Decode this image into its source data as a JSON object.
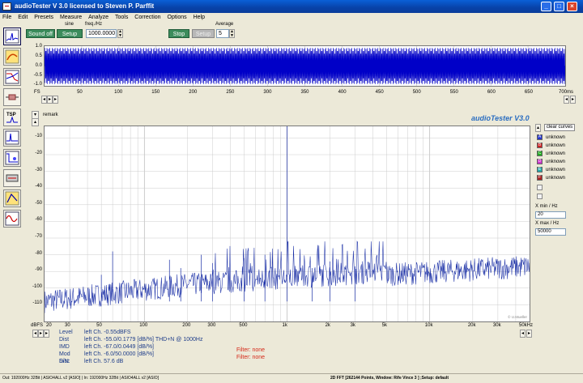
{
  "window": {
    "title": "audioTester  V 3.0   licensed to Steven P. Parffit",
    "min": "_",
    "max": "□",
    "close": "×"
  },
  "menu": [
    "File",
    "Edit",
    "Presets",
    "Measure",
    "Analyze",
    "Tools",
    "Correction",
    "Options",
    "Help"
  ],
  "toolbar": {
    "sound_off": "Sound off",
    "sine_label": "sine",
    "setup1": "Setup",
    "freq_label": "freq./Hz",
    "freq_value": "1000.0000",
    "stop": "Stop",
    "setup2": "Setup",
    "average_label": "Average",
    "average_value": "5"
  },
  "scope": {
    "y_ticks": [
      "1.0",
      "0.5",
      "0.0",
      "-0.5",
      "-1.0"
    ],
    "x_ticks": [
      "50",
      "100",
      "150",
      "200",
      "250",
      "300",
      "350",
      "400",
      "450",
      "500",
      "550",
      "600",
      "650",
      "700ms"
    ],
    "fs_label": "FS",
    "color": "#0000c8"
  },
  "remark": "remark",
  "brand": "audioTester  V3.0",
  "fft": {
    "y_ticks": [
      "-10",
      "-20",
      "-30",
      "-40",
      "-50",
      "-60",
      "-70",
      "-80",
      "-90",
      "-100",
      "-110"
    ],
    "y_unit": "dBFS",
    "x_ticks": [
      "20",
      "30",
      "50",
      "100",
      "200",
      "300",
      "500",
      "1k",
      "2k",
      "3k",
      "5k",
      "10k",
      "20k",
      "30k",
      "50kHz"
    ],
    "watermark": "© U.Mueller",
    "color": "#1a2fa6"
  },
  "legend": {
    "clear": "clear curves",
    "items": [
      {
        "letter": "A",
        "label": "unknown",
        "color": "#2233cc"
      },
      {
        "letter": "B",
        "label": "unknown",
        "color": "#cc2222"
      },
      {
        "letter": "C",
        "label": "unknown",
        "color": "#22aa22"
      },
      {
        "letter": "D",
        "label": "unknown",
        "color": "#cc33cc"
      },
      {
        "letter": "E",
        "label": "unknown",
        "color": "#22aaaa"
      },
      {
        "letter": "F",
        "label": "unknown",
        "color": "#aa2222"
      }
    ],
    "xmin_label": "X min / Hz",
    "xmin_value": "20",
    "xmax_label": "X max / Hz",
    "xmax_value": "50000"
  },
  "results": [
    {
      "label": "Level",
      "value": "left Ch. -0.55dBFS"
    },
    {
      "label": "Dist",
      "value": "left Ch. -55.0/0.1779 [dB/%] THD+N  @ 1000Hz"
    },
    {
      "label": "IMD  :",
      "value": "left Ch. -67.0/0.0449 [dB/%]"
    },
    {
      "label": "Mod Dist",
      "value": "left Ch. -6.0/50.0000 [dB/%]"
    },
    {
      "label": "S/N:",
      "value": "left Ch. 57.6 dB"
    }
  ],
  "filters": [
    "Filter: none",
    "Filter: none"
  ],
  "status": {
    "out": "Out: 192000Hz 32Bit  |  ASIO4ALL v2 [ASIO]  |  In: 192000Hz 32Bit  |  ASIO4ALL v2 [ASIO]",
    "fft": "2D FFT [262144 Points, Window: Rife Vince 3 ]  ;Setup: default"
  }
}
